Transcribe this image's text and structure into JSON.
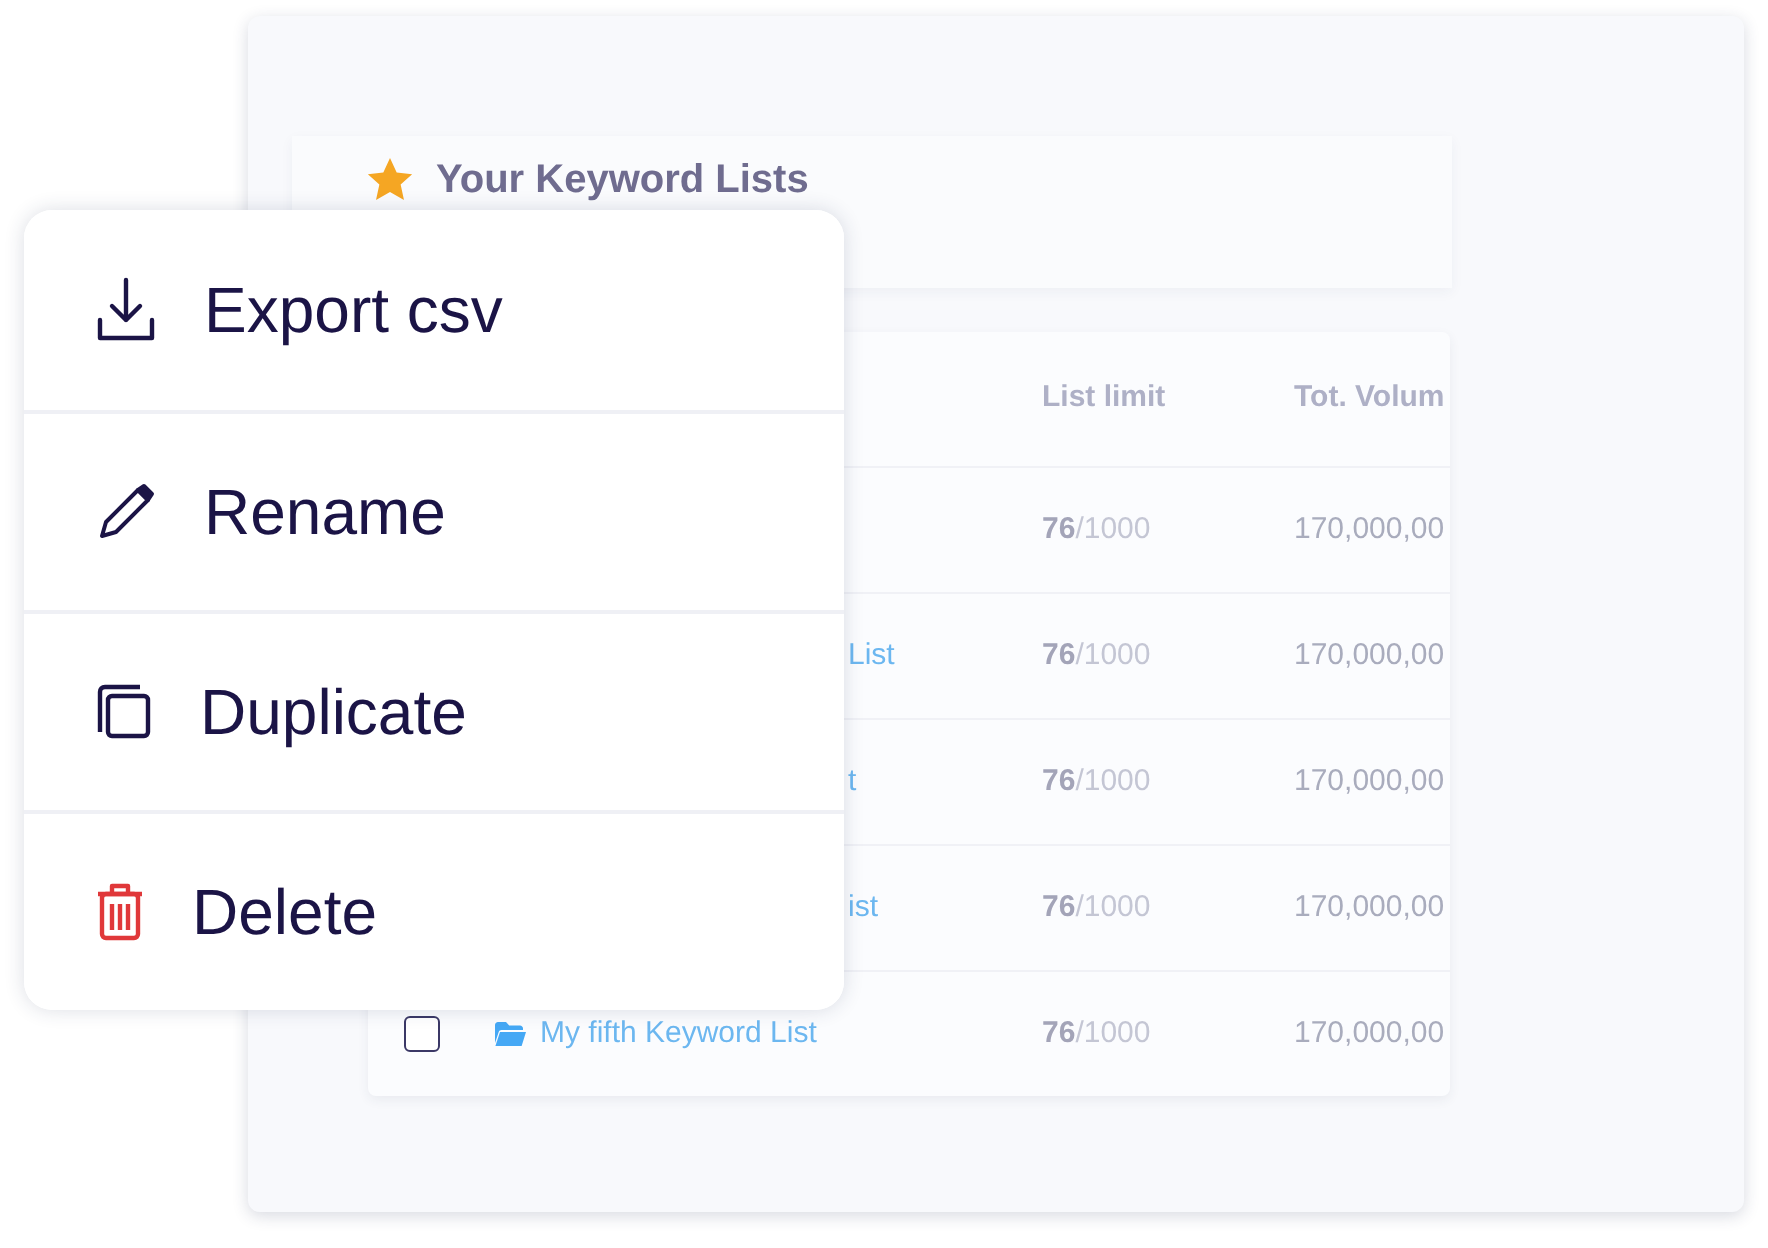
{
  "header": {
    "title": "Your Keyword Lists"
  },
  "table": {
    "columns": [
      "List limit",
      "Tot. Volum"
    ],
    "rows": [
      {
        "name": null,
        "used": "76",
        "limit": "/1000",
        "volume": "170,000,00"
      },
      {
        "name": "List",
        "partial": true,
        "used": "76",
        "limit": "/1000",
        "volume": "170,000,00"
      },
      {
        "name": "t",
        "partial": true,
        "used": "76",
        "limit": "/1000",
        "volume": "170,000,00"
      },
      {
        "name": "ist",
        "partial": true,
        "used": "76",
        "limit": "/1000",
        "volume": "170,000,00"
      },
      {
        "name": "My fifth Keyword List",
        "partial": false,
        "checked": false,
        "used": "76",
        "limit": "/1000",
        "volume": "170,000,00"
      }
    ]
  },
  "menu": [
    {
      "kind": "export",
      "label": "Export csv"
    },
    {
      "kind": "rename",
      "label": "Rename"
    },
    {
      "kind": "duplicate",
      "label": "Duplicate"
    },
    {
      "kind": "delete",
      "label": "Delete"
    }
  ]
}
